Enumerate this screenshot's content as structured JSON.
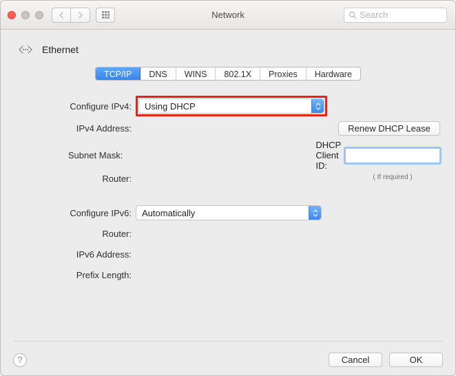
{
  "window": {
    "title": "Network",
    "search_placeholder": "Search"
  },
  "header": {
    "interface_label": "Ethernet"
  },
  "tabs": {
    "items": [
      {
        "label": "TCP/IP",
        "selected": true
      },
      {
        "label": "DNS",
        "selected": false
      },
      {
        "label": "WINS",
        "selected": false
      },
      {
        "label": "802.1X",
        "selected": false
      },
      {
        "label": "Proxies",
        "selected": false
      },
      {
        "label": "Hardware",
        "selected": false
      }
    ]
  },
  "ipv4": {
    "configure_label": "Configure IPv4:",
    "configure_value": "Using DHCP",
    "address_label": "IPv4 Address:",
    "address_value": "",
    "subnet_label": "Subnet Mask:",
    "subnet_value": "",
    "router_label": "Router:",
    "router_value": "",
    "renew_button": "Renew DHCP Lease",
    "client_id_label": "DHCP Client ID:",
    "client_id_value": "",
    "client_id_hint": "( If required )"
  },
  "ipv6": {
    "configure_label": "Configure IPv6:",
    "configure_value": "Automatically",
    "router_label": "Router:",
    "router_value": "",
    "address_label": "IPv6 Address:",
    "address_value": "",
    "prefix_label": "Prefix Length:",
    "prefix_value": ""
  },
  "footer": {
    "cancel": "Cancel",
    "ok": "OK",
    "help": "?"
  }
}
